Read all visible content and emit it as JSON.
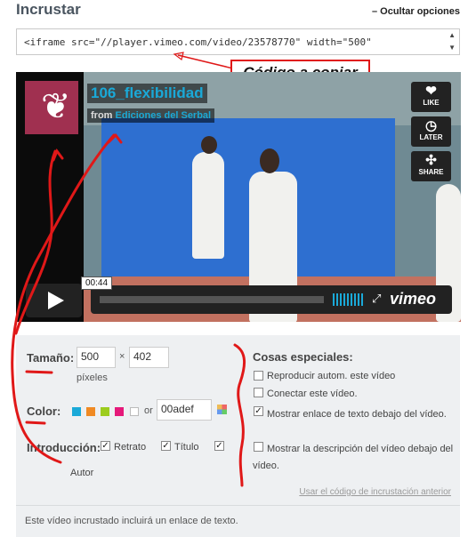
{
  "header": {
    "title": "Incrustar",
    "hide_options": "– Ocultar opciones"
  },
  "embed_code": {
    "value": "<iframe src=\"//player.vimeo.com/video/23578770\" width=\"500\""
  },
  "annotation": {
    "label": "Código a copiar"
  },
  "player": {
    "title": "106_flexibilidad",
    "from_prefix": "from",
    "author": "Ediciones del Serbal",
    "buttons": [
      {
        "icon": "heart-icon",
        "label": "LIKE"
      },
      {
        "icon": "clock-icon",
        "label": "LATER"
      },
      {
        "icon": "share-icon",
        "label": "SHARE"
      }
    ],
    "time": "00:44",
    "brand": "vimeo"
  },
  "settings": {
    "size": {
      "label": "Tamaño:",
      "width": "500",
      "times": "×",
      "height": "402",
      "unit": "píxeles"
    },
    "color": {
      "label": "Color:",
      "swatches": [
        "#1aa9d8",
        "#f08a24",
        "#9ccc1e",
        "#e5197a",
        "#ffffff"
      ],
      "or": "or",
      "value": "00adef"
    },
    "intro": {
      "label": "Introducción:",
      "portrait": "Retrato",
      "title": "Título",
      "author": "Autor"
    },
    "special": {
      "label": "Cosas especiales:",
      "autoplay": "Reproducir autom. este vídeo",
      "loop": "Conectar este vídeo.",
      "show_link": "Mostrar enlace de texto debajo del vídeo.",
      "show_desc": "Mostrar la descripción del vídeo debajo del vídeo."
    },
    "old_code_link": "Usar el código de incrustación anterior",
    "footer": "Este vídeo incrustado incluirá un enlace de texto."
  }
}
